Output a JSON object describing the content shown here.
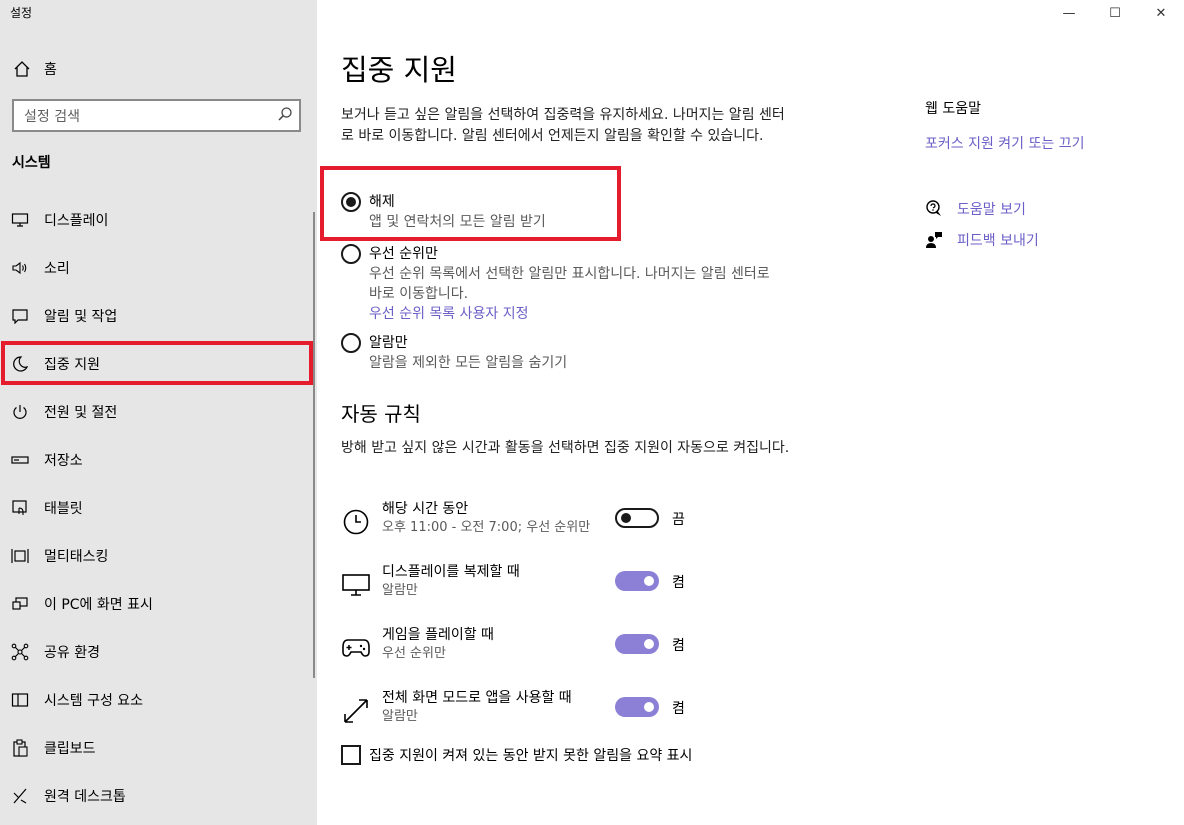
{
  "window": {
    "title": "설정",
    "controls": {
      "minimize": "—",
      "maximize": "☐",
      "close": "✕"
    }
  },
  "sidebar": {
    "home_label": "홈",
    "search_placeholder": "설정 검색",
    "section_label": "시스템",
    "items": [
      {
        "label": "디스플레이",
        "icon": "display-icon"
      },
      {
        "label": "소리",
        "icon": "speaker-icon"
      },
      {
        "label": "알림 및 작업",
        "icon": "notification-icon"
      },
      {
        "label": "집중 지원",
        "icon": "moon-icon",
        "selected": true
      },
      {
        "label": "전원 및 절전",
        "icon": "power-icon"
      },
      {
        "label": "저장소",
        "icon": "storage-icon"
      },
      {
        "label": "태블릿",
        "icon": "tablet-icon"
      },
      {
        "label": "멀티태스킹",
        "icon": "multitasking-icon"
      },
      {
        "label": "이 PC에 화면 표시",
        "icon": "project-icon"
      },
      {
        "label": "공유 환경",
        "icon": "share-icon"
      },
      {
        "label": "시스템 구성 요소",
        "icon": "components-icon"
      },
      {
        "label": "클립보드",
        "icon": "clipboard-icon"
      },
      {
        "label": "원격 데스크톱",
        "icon": "remote-desktop-icon"
      }
    ]
  },
  "main": {
    "title": "집중 지원",
    "description": "보거나 듣고 싶은 알림을 선택하여 집중력을 유지하세요. 나머지는 알림 센터로 바로 이동합니다. 알림 센터에서 언제든지 알림을 확인할 수 있습니다.",
    "options": [
      {
        "label": "해제",
        "sub": "앱 및 연락처의 모든 알림 받기",
        "selected": true
      },
      {
        "label": "우선 순위만",
        "sub": "우선 순위 목록에서 선택한 알림만 표시합니다. 나머지는 알림 센터로 바로 이동합니다.",
        "link": "우선 순위 목록 사용자 지정",
        "selected": false
      },
      {
        "label": "알람만",
        "sub": "알람을 제외한 모든 알림을 숨기기",
        "selected": false
      }
    ],
    "auto_rules_title": "자동 규칙",
    "auto_rules_description": "방해 받고 싶지 않은 시간과 활동을 선택하면 집중 지원이 자동으로 켜집니다.",
    "rules": [
      {
        "title": "해당 시간 동안",
        "sub": "오후 11:00 - 오전 7:00; 우선 순위만",
        "state": "끔",
        "on": false,
        "icon": "clock-icon"
      },
      {
        "title": "디스플레이를 복제할 때",
        "sub": "알람만",
        "state": "켬",
        "on": true,
        "icon": "monitor-icon"
      },
      {
        "title": "게임을 플레이할 때",
        "sub": "우선 순위만",
        "state": "켬",
        "on": true,
        "icon": "gamepad-icon"
      },
      {
        "title": "전체 화면 모드로 앱을 사용할 때",
        "sub": "알람만",
        "state": "켬",
        "on": true,
        "icon": "fullscreen-icon"
      }
    ],
    "summary_checkbox": "집중 지원이 켜져 있는 동안 받지 못한 알림을 요약 표시"
  },
  "help": {
    "heading": "웹 도움말",
    "link": "포커스 지원 켜기 또는 끄기",
    "get_help": "도움말 보기",
    "feedback": "피드백 보내기"
  }
}
